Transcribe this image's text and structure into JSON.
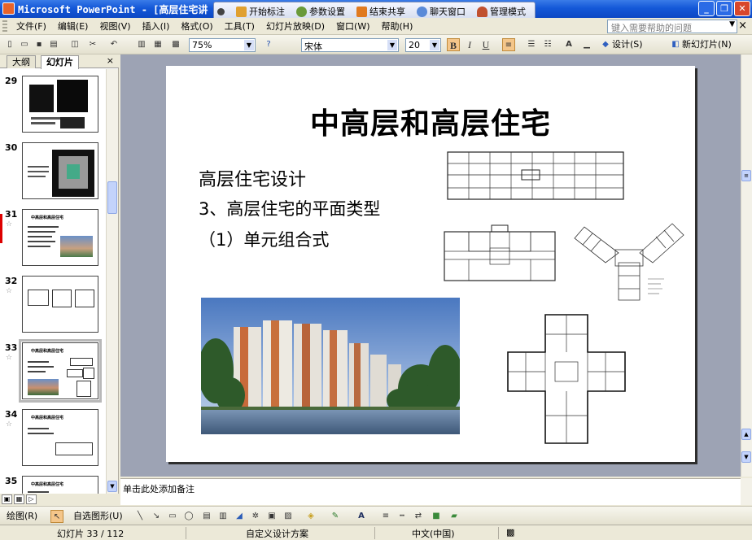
{
  "window": {
    "title": "Microsoft PowerPoint - [高层住宅讲",
    "min_label": "_",
    "restore_label": "❐",
    "close_label": "✕"
  },
  "floating_toolbar": {
    "items": [
      {
        "label": "开始标注",
        "icon": "pen-icon",
        "color": "#E0A030"
      },
      {
        "label": "参数设置",
        "icon": "settings-icon",
        "color": "#6A9A3A"
      },
      {
        "label": "结束共享",
        "icon": "stop-share-icon",
        "color": "#E07A20"
      },
      {
        "label": "聊天窗口",
        "icon": "chat-icon",
        "color": "#5A8AD8"
      },
      {
        "label": "管理模式",
        "icon": "user-icon",
        "color": "#C05030"
      }
    ]
  },
  "menu": {
    "items": [
      "文件(F)",
      "编辑(E)",
      "视图(V)",
      "插入(I)",
      "格式(O)",
      "工具(T)",
      "幻灯片放映(D)",
      "窗口(W)",
      "帮助(H)"
    ],
    "help_placeholder": "键入需要帮助的问题",
    "close_doc": "×"
  },
  "toolbar": {
    "zoom": "75%",
    "font": "宋体",
    "font_size": "20",
    "bold": "B",
    "italic": "I",
    "underline": "U",
    "font_grow": "A",
    "design_label": "设计(S)",
    "new_slide_label": "新幻灯片(N)"
  },
  "left_pane": {
    "tab_outline": "大纲",
    "tab_slides": "幻灯片",
    "close": "×",
    "slides": [
      {
        "num": "29",
        "title": ""
      },
      {
        "num": "30",
        "title": ""
      },
      {
        "num": "31",
        "title": "中高层和高层住宅"
      },
      {
        "num": "32",
        "title": ""
      },
      {
        "num": "33",
        "title": "中高层和高层住宅"
      },
      {
        "num": "34",
        "title": "中高层和高层住宅"
      },
      {
        "num": "35",
        "title": "中高层和高层住宅"
      }
    ]
  },
  "slide": {
    "title": "中高层和高层住宅",
    "line1": "高层住宅设计",
    "line2": "3、高层住宅的平面类型",
    "line3": "（1）单元组合式"
  },
  "notes": {
    "placeholder": "单击此处添加备注"
  },
  "drawing_toolbar": {
    "draw_label": "绘图(R)",
    "autoshapes_label": "自选图形(U)"
  },
  "status": {
    "slide_pos": "幻灯片 33 / 112",
    "design": "自定义设计方案",
    "language": "中文(中国)"
  },
  "colors": {
    "titlebar": "#1458D8",
    "workspace": "#9DA3B4"
  }
}
